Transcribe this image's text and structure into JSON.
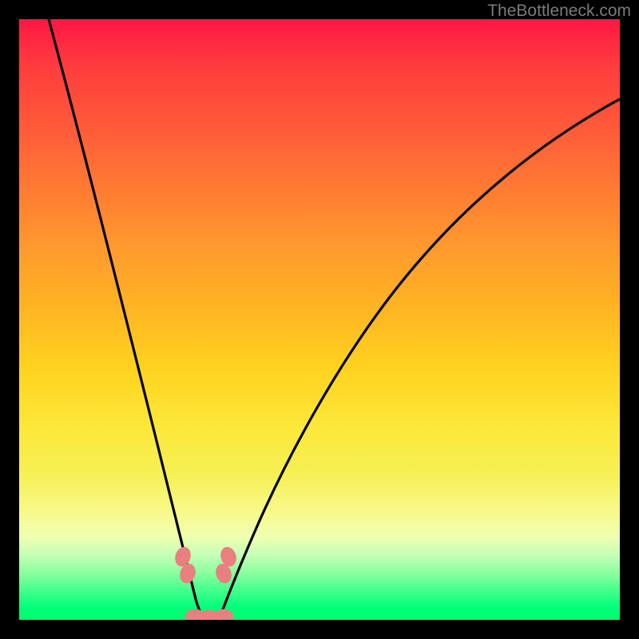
{
  "watermark": "TheBottleneck.com",
  "chart_data": {
    "type": "line",
    "title": "",
    "xlabel": "",
    "ylabel": "",
    "ylim": [
      0,
      100
    ],
    "xlim": [
      0,
      100
    ],
    "series": [
      {
        "name": "left-curve",
        "x": [
          5,
          8,
          12,
          16,
          20,
          23,
          25,
          27,
          28,
          29,
          30
        ],
        "values": [
          100,
          80,
          58,
          40,
          26,
          16,
          10,
          6,
          4,
          2,
          0
        ]
      },
      {
        "name": "right-curve",
        "x": [
          33,
          35,
          38,
          42,
          48,
          55,
          63,
          72,
          82,
          92,
          100
        ],
        "values": [
          0,
          4,
          10,
          18,
          28,
          38,
          48,
          57,
          65,
          72,
          78
        ]
      }
    ],
    "markers": [
      {
        "name": "left-upper",
        "x": 26.5,
        "y": 10
      },
      {
        "name": "left-lower",
        "x": 27.3,
        "y": 7
      },
      {
        "name": "right-upper",
        "x": 34.0,
        "y": 10
      },
      {
        "name": "right-lower",
        "x": 33.3,
        "y": 7
      },
      {
        "name": "bottom-left",
        "x": 29,
        "y": 0.5
      },
      {
        "name": "bottom-mid",
        "x": 31,
        "y": 0.5
      },
      {
        "name": "bottom-right",
        "x": 33,
        "y": 0.5
      }
    ]
  }
}
